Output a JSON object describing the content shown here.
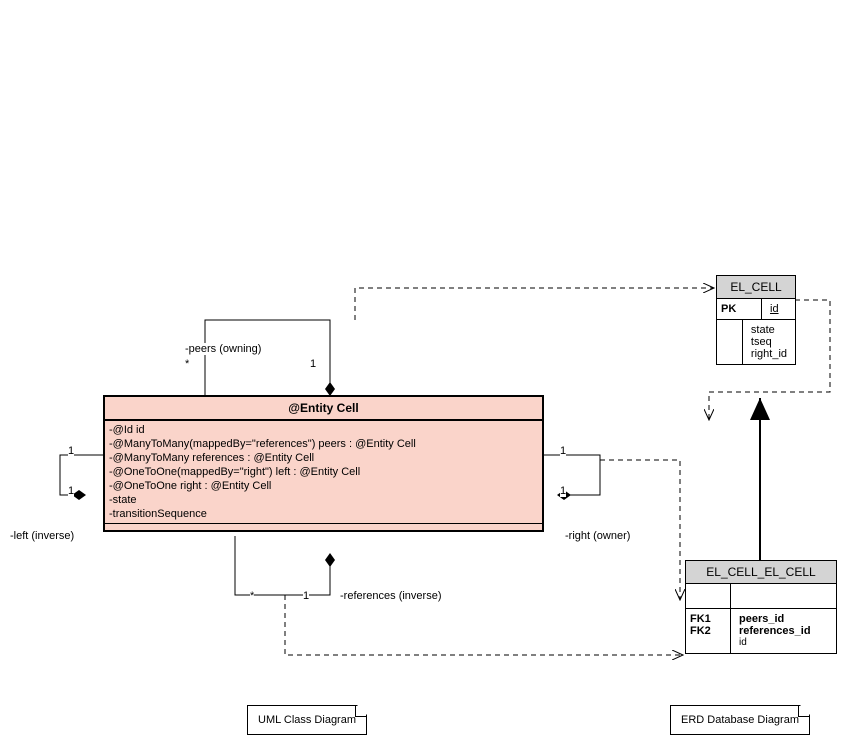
{
  "uml_class": {
    "title": "@Entity Cell",
    "attributes": [
      "-@Id id",
      "-@ManyToMany(mappedBy=\"references\") peers : @Entity Cell",
      "-@ManyToMany references : @Entity Cell",
      "-@OneToOne(mappedBy=\"right\") left : @Entity Cell",
      "-@OneToOne right : @Entity Cell",
      "-state",
      "-transitionSequence"
    ]
  },
  "assoc_labels": {
    "peers_owning": "-peers (owning)",
    "left_inverse": "-left (inverse)",
    "right_owner": "-right (owner)",
    "references_inverse": "-references (inverse)",
    "peers_star": "*",
    "peers_one": "1",
    "left_one_top": "1",
    "left_one_bottom": "1",
    "right_one_top": "1",
    "right_one_bottom": "1",
    "ref_star": "*",
    "ref_one": "1"
  },
  "erd_el_cell": {
    "title": "EL_CELL",
    "pk_label": "PK",
    "pk_field": "id",
    "fields": [
      "state",
      "tseq",
      "right_id"
    ]
  },
  "erd_el_cell_el_cell": {
    "title": "EL_CELL_EL_CELL",
    "fk1_label": "FK1",
    "fk2_label": "FK2",
    "fk1_field": "peers_id",
    "fk2_field": "references_id",
    "id_field": "id"
  },
  "notes": {
    "uml": "UML Class Diagram",
    "erd": "ERD Database Diagram"
  },
  "chart_data": {
    "type": "diagram",
    "uml_classes": [
      {
        "name": "@Entity Cell",
        "attributes": [
          {
            "annotation": "@Id",
            "name": "id"
          },
          {
            "annotation": "@ManyToMany(mappedBy=\"references\")",
            "name": "peers",
            "type": "@Entity Cell"
          },
          {
            "annotation": "@ManyToMany",
            "name": "references",
            "type": "@Entity Cell"
          },
          {
            "annotation": "@OneToOne(mappedBy=\"right\")",
            "name": "left",
            "type": "@Entity Cell"
          },
          {
            "annotation": "@OneToOne",
            "name": "right",
            "type": "@Entity Cell"
          },
          {
            "name": "state"
          },
          {
            "name": "transitionSequence"
          }
        ],
        "self_associations": [
          {
            "role": "peers (owning)",
            "multiplicity_a": "*",
            "multiplicity_b": "1",
            "aggregation": "composite"
          },
          {
            "role": "left (inverse)",
            "multiplicity_a": "1",
            "multiplicity_b": "1",
            "aggregation": "composite"
          },
          {
            "role": "right (owner)",
            "multiplicity_a": "1",
            "multiplicity_b": "1",
            "aggregation": "composite"
          },
          {
            "role": "references (inverse)",
            "multiplicity_a": "*",
            "multiplicity_b": "1",
            "aggregation": "composite"
          }
        ]
      }
    ],
    "erd_tables": [
      {
        "name": "EL_CELL",
        "pk": [
          "id"
        ],
        "columns": [
          "state",
          "tseq",
          "right_id"
        ]
      },
      {
        "name": "EL_CELL_EL_CELL",
        "fks": [
          {
            "name": "FK1",
            "column": "peers_id"
          },
          {
            "name": "FK2",
            "column": "references_id"
          }
        ],
        "columns": [
          "id"
        ]
      }
    ],
    "erd_relationships": [
      {
        "from": "EL_CELL_EL_CELL",
        "to": "EL_CELL"
      },
      {
        "from": "EL_CELL",
        "to": "EL_CELL",
        "self": true
      }
    ],
    "dependencies": [
      {
        "from": "@Entity Cell",
        "to": "EL_CELL",
        "style": "dashed"
      },
      {
        "from": "@Entity Cell",
        "to": "EL_CELL_EL_CELL",
        "style": "dashed"
      }
    ]
  }
}
